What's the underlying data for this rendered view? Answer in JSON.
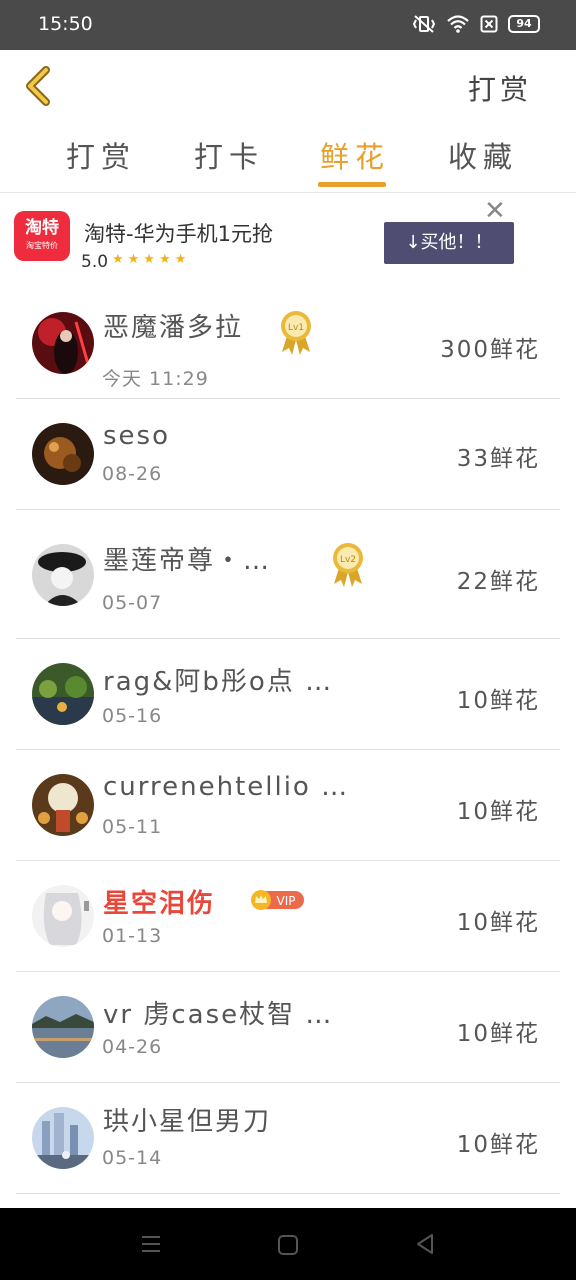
{
  "status_bar": {
    "time": "15:50",
    "battery": "94"
  },
  "header": {
    "action_label": "打赏"
  },
  "tabs": [
    {
      "label": "打赏"
    },
    {
      "label": "打卡"
    },
    {
      "label": "鲜花",
      "active": true
    },
    {
      "label": "收藏"
    }
  ],
  "ad": {
    "logo_text": "淘特",
    "logo_subtext": "淘宝特价",
    "title": "淘特-华为手机1元抢",
    "rating": "5.0",
    "button_label": "↓买他！！",
    "close_symbol": "✕"
  },
  "list": [
    {
      "name": "恶魔潘多拉",
      "date": "今天 11:29",
      "amount": "300鲜花",
      "medal": "Lv1"
    },
    {
      "name": "seso",
      "date": "08-26",
      "amount": "33鲜花"
    },
    {
      "name": "墨莲帝尊・…",
      "date": "05-07",
      "amount": "22鲜花",
      "medal": "Lv2"
    },
    {
      "name": "rag&阿b彤o点 …",
      "date": "05-16",
      "amount": "10鲜花"
    },
    {
      "name": "currenehtellio …",
      "date": "05-11",
      "amount": "10鲜花"
    },
    {
      "name": "星空泪伤",
      "date": "01-13",
      "amount": "10鲜花",
      "vip": "VIP"
    },
    {
      "name": "vr 虏case杖智 …",
      "date": "04-26",
      "amount": "10鲜花"
    },
    {
      "name": "珙小星但男刀",
      "date": "05-14",
      "amount": "10鲜花"
    }
  ],
  "colors": {
    "accent": "#e8a02a",
    "vip_name": "#e8473a",
    "ad_button": "#4f4d72"
  }
}
